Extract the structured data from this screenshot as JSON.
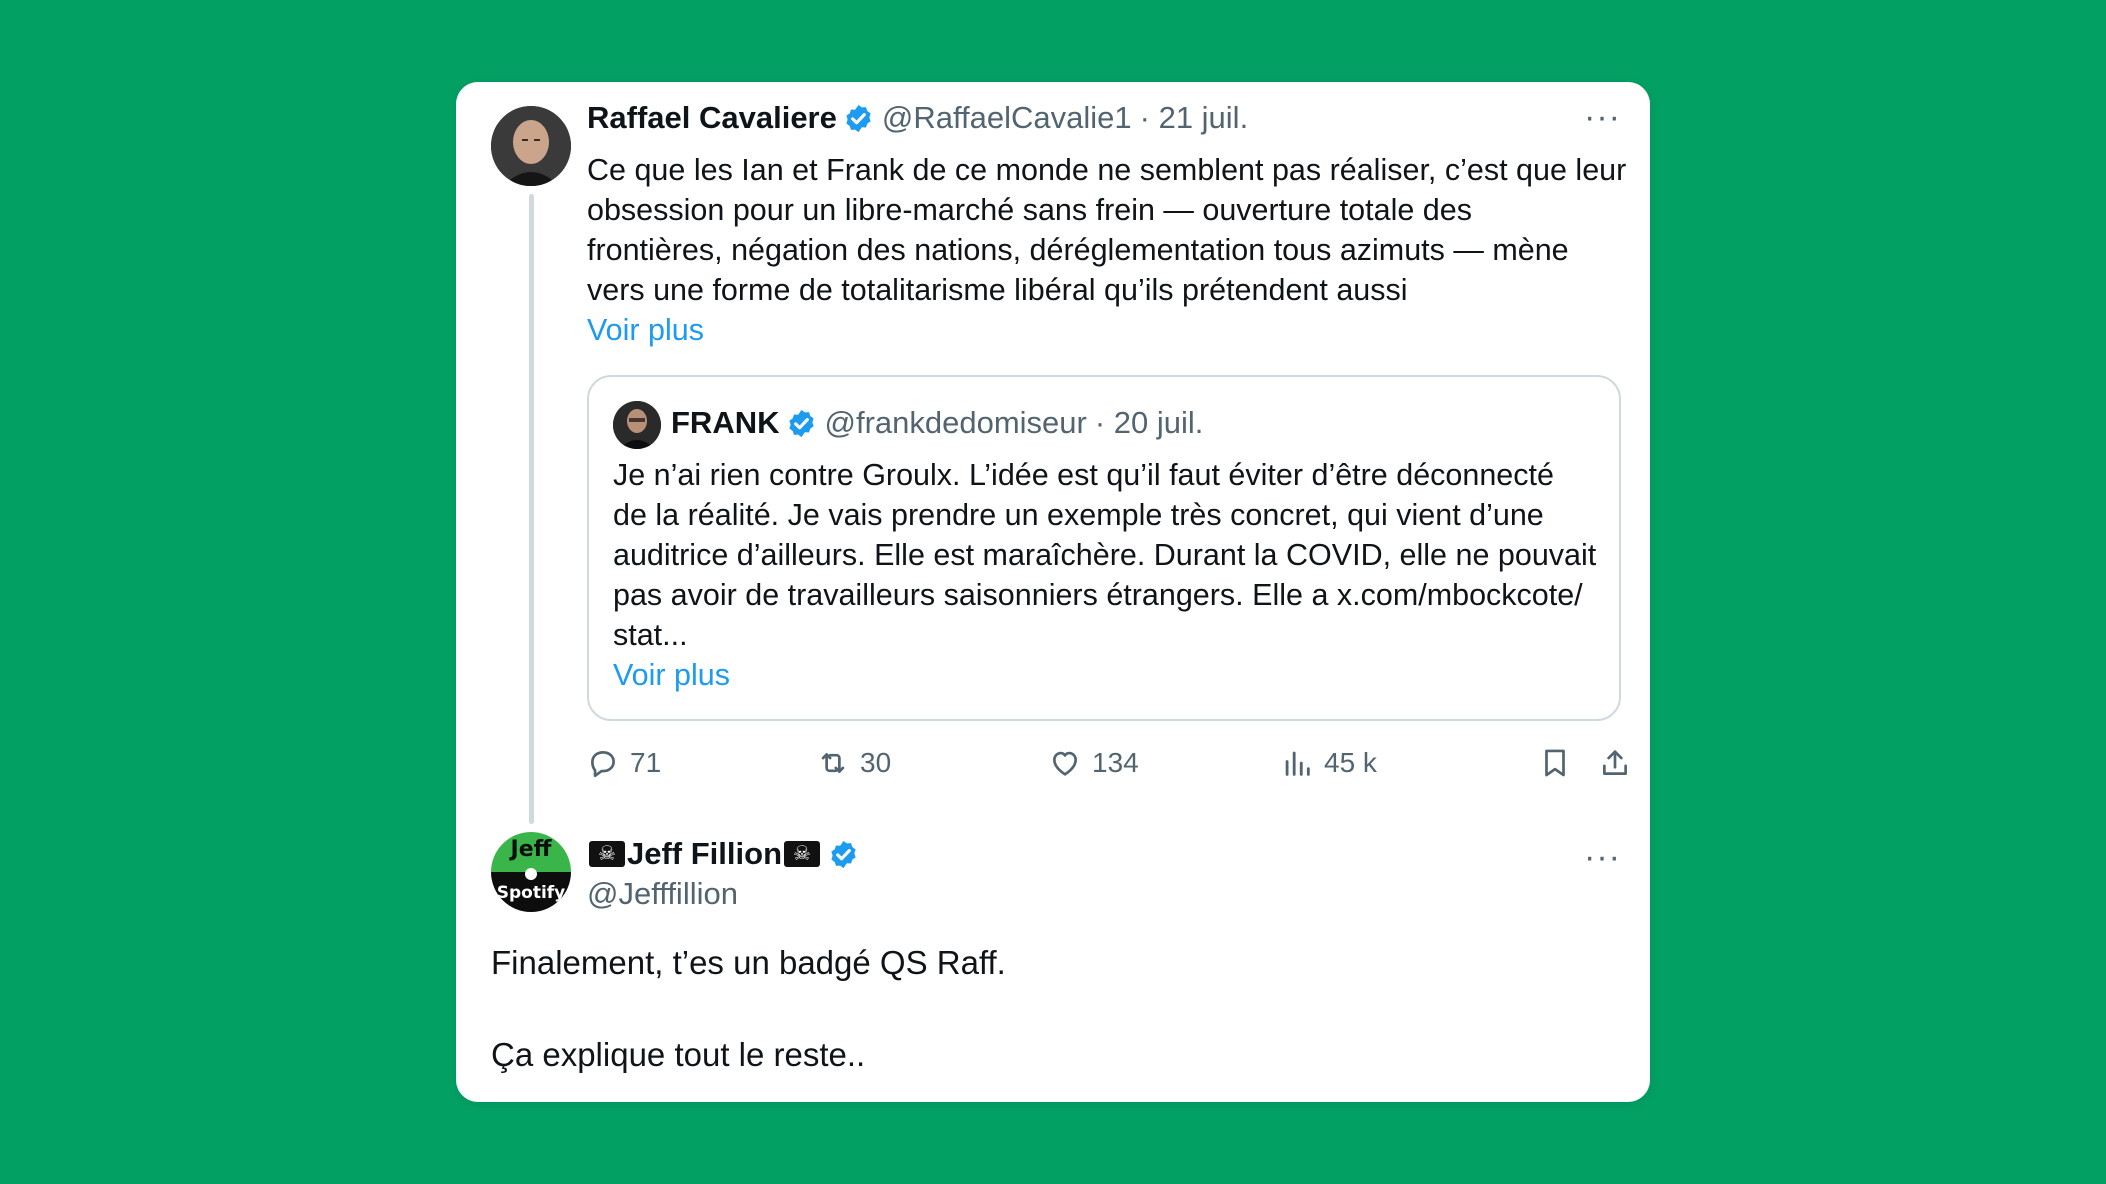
{
  "tweet": {
    "author_name": "Raffael Cavaliere",
    "handle": "@RaffaelCavalie1",
    "date": "· 21 juil.",
    "more": "···",
    "text_lines": [
      "Ce que les Ian et Frank de ce monde ne semblent pas réaliser, c’est que leur",
      "obsession pour un libre-marché sans frein — ouverture totale des",
      "frontières, négation des nations, déréglementation tous azimuts — mène",
      "vers une forme de totalitarisme libéral qu’ils prétendent aussi"
    ],
    "show_more": "Voir plus",
    "quote": {
      "author_name": "FRANK",
      "handle": "@frankdedomiseur",
      "date": "· 20 juil.",
      "text_lines": [
        "Je n’ai rien contre Groulx. L’idée est qu’il faut éviter d’être déconnecté",
        "de la réalité. Je vais prendre un exemple très concret, qui vient d’une",
        "auditrice d’ailleurs. Elle est maraîchère. Durant la COVID, elle ne pouvait",
        "pas avoir de travailleurs saisonniers étrangers. Elle a x.com/mbockcote/",
        "stat..."
      ],
      "show_more": "Voir plus"
    },
    "actions": {
      "replies": "71",
      "retweets": "30",
      "likes": "134",
      "views": "45 k"
    }
  },
  "reply": {
    "author_name": "Jeff Fillion",
    "handle": "@Jefffillion",
    "more": "···",
    "avatar_text_top": "Jeff",
    "avatar_text_bottom": "Spotify",
    "text_lines": [
      "Finalement, t’es un badgé QS Raff.",
      "",
      "Ça explique tout le reste.."
    ]
  },
  "colors": {
    "background": "#03a064",
    "link": "#1d9bf0",
    "verified": "#1d9bf0",
    "muted": "#536471"
  },
  "icons": [
    "verified-badge-icon",
    "more-icon",
    "reply-icon",
    "retweet-icon",
    "like-icon",
    "views-icon",
    "bookmark-icon",
    "share-icon",
    "pirate-flag-icon"
  ]
}
